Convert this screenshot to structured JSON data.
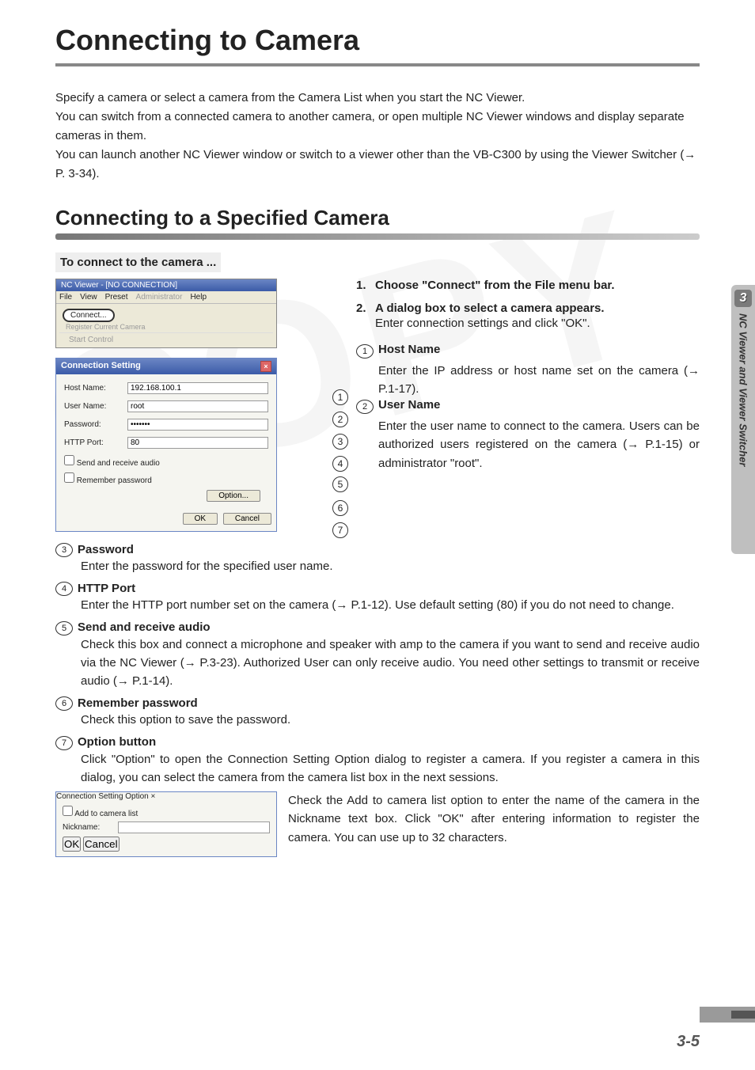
{
  "title": "Connecting to Camera",
  "intro": {
    "p1": "Specify a camera or select a camera from the Camera List when you start the NC Viewer.",
    "p2": "You can switch from a connected camera to another camera, or open multiple NC Viewer windows and display separate cameras in them.",
    "p3": "You can launch another NC Viewer window or switch to a viewer other than the VB-C300 by using the Viewer Switcher (→ P. 3-34)."
  },
  "section_title": "Connecting to a Specified Camera",
  "subhead": "To connect to the camera ...",
  "ncviewer": {
    "title": "NC Viewer - [NO CONNECTION]",
    "menu": {
      "file": "File",
      "view": "View",
      "preset": "Preset",
      "admin": "Administrator",
      "help": "Help"
    },
    "connect": "Connect...",
    "register": "Register Current Camera",
    "start": "Start Control"
  },
  "dlg": {
    "title": "Connection Setting",
    "host_label": "Host Name:",
    "host_value": "192.168.100.1",
    "user_label": "User Name:",
    "user_value": "root",
    "pw_label": "Password:",
    "pw_value": "•••••••",
    "port_label": "HTTP Port:",
    "port_value": "80",
    "send_audio": "Send and receive audio",
    "remember": "Remember password",
    "option": "Option...",
    "ok": "OK",
    "cancel": "Cancel"
  },
  "steps": {
    "s1_num": "1.",
    "s1": "Choose \"Connect\" from the File menu bar.",
    "s2_num": "2.",
    "s2": "A dialog box to select a camera appears.",
    "s2_body": "Enter connection settings and click \"OK\"."
  },
  "items_right": [
    {
      "n": "1",
      "title": "Host Name",
      "body": "Enter the IP address or host name set on the camera (→ P.1-17)."
    },
    {
      "n": "2",
      "title": "User Name",
      "body": "Enter the user name to connect to the camera. Users can be authorized users registered on the camera (→ P.1-15) or administrator \"root\"."
    }
  ],
  "items_full": [
    {
      "n": "3",
      "title": "Password",
      "body": "Enter the password for the specified user name."
    },
    {
      "n": "4",
      "title": "HTTP Port",
      "body": "Enter the HTTP port number set on the camera (→ P.1-12). Use default setting (80) if you do not need to change."
    },
    {
      "n": "5",
      "title": "Send and receive audio",
      "body": "Check this box and connect a microphone and speaker with amp to the camera if you want to send and receive audio via the NC Viewer (→ P.3-23). Authorized User can only receive audio. You need other settings to transmit or receive audio (→ P.1-14)."
    },
    {
      "n": "6",
      "title": "Remember password",
      "body": "Check this option to save the password."
    },
    {
      "n": "7",
      "title": "Option button",
      "body": "Click \"Option\" to open the Connection Setting Option dialog to register a camera. If you register a camera in this dialog, you can select the camera from the camera list box in the next sessions."
    }
  ],
  "opt_dlg": {
    "title": "Connection Setting Option",
    "add": "Add to camera list",
    "nick_label": "Nickname:",
    "nick_value": "",
    "ok": "OK",
    "cancel": "Cancel"
  },
  "opt_text": "Check the Add to camera list option to enter the name of the camera in the Nickname text box. Click \"OK\" after entering information to register the camera. You can use up to 32 characters.",
  "sidebar": {
    "chapter": "3",
    "label": "NC Viewer and Viewer Switcher"
  },
  "page_number": "3-5",
  "callout_labels": [
    "1",
    "2",
    "3",
    "4",
    "5",
    "6",
    "7"
  ]
}
